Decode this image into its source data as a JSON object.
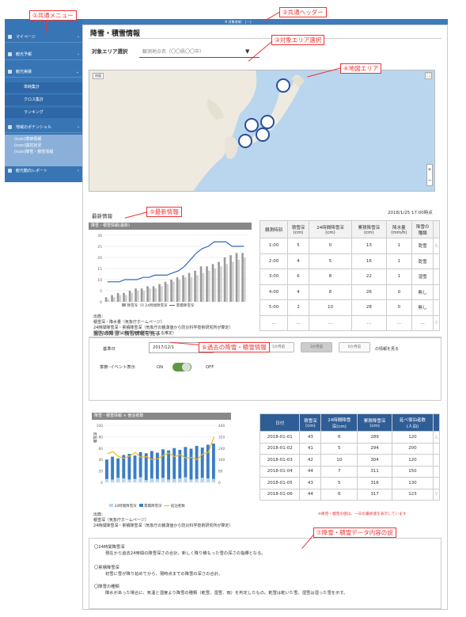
{
  "annotations": {
    "a1": "①共通メニュー",
    "a2": "②共通ヘッダー",
    "a3": "③対象エリア選択",
    "a4": "④地図エリア",
    "a5": "⑤最新情報",
    "a6": "⑥過去の降雪・積雪情報",
    "a7": "⑦降雪・積雪データ内容の説"
  },
  "header": {
    "center_text": "※ 対象地域： | ─ |"
  },
  "sidebar": {
    "items": [
      {
        "label": "マイページ"
      },
      {
        "label": "観光予報"
      },
      {
        "label": "観光実績"
      },
      {
        "label": "地域のポテンシャル"
      },
      {
        "label": "観光動向レポート"
      }
    ],
    "sub_items": [
      {
        "label": "単純集計"
      },
      {
        "label": "クロス集計"
      },
      {
        "label": "ランキング"
      }
    ],
    "extra_lines": [
      "(icon)季節情報",
      "(icon)開花状況",
      "(icon)降雪・積雪情報"
    ]
  },
  "page": {
    "title": "降雪・積雪情報"
  },
  "area": {
    "label": "対象エリア選択",
    "value": "観測地点名（〇〇県〇〇市）"
  },
  "latest": {
    "heading": "最新情報",
    "timestamp": "2018/1/25 17:00時点",
    "chart_title": "降雪・積雪情報(最新)",
    "legend": [
      "降雪深",
      "24時間降雪深",
      "累積降雪深"
    ],
    "source": [
      "出典：",
      "積雪深・降水量（気象庁ホームページ）",
      "24時間降雪深・累積降雪深（気象庁の観測値から防災科学技術研究所が算定）",
      "降雪の種類（防災科学技術研究所による推定）"
    ],
    "table_headers": [
      "観測時刻",
      "積雪深\n(cm)",
      "24時間降雪深\n(cm)",
      "累積降雪深\n(cm)",
      "降水量\n(mm/h)",
      "降雪の\n種類"
    ],
    "rows": [
      [
        "1:00",
        "5",
        "0",
        "13",
        "1",
        "乾雪"
      ],
      [
        "2:00",
        "4",
        "5",
        "16",
        "1",
        "乾雪"
      ],
      [
        "3:00",
        "6",
        "8",
        "22",
        "1",
        "湿雪"
      ],
      [
        "4:00",
        "4",
        "8",
        "26",
        "0",
        "無し"
      ],
      [
        "5:00",
        "2",
        "10",
        "28",
        "0",
        "無し"
      ],
      [
        "…",
        "…",
        "…",
        "…",
        "…",
        "…"
      ]
    ]
  },
  "past": {
    "heading": "過去の降雪・積雪情報を見る",
    "base_date_label": "基準日",
    "base_date": "2017/12/1",
    "kara": "から",
    "buttons": [
      "1か月前",
      "3か月前",
      "6か月前"
    ],
    "after": "の情報を見る",
    "season_label": "季節･イベント表示",
    "on": "ON",
    "off": "OFF",
    "chart_title": "降雪・積雪情報 × 宿泊者数",
    "ylabel": "積雪深",
    "legend": [
      "24時間降雪深",
      "累積降雪深",
      "宿泊者数"
    ],
    "table_headers": [
      "日付",
      "積雪深\n(cm)",
      "24時間降雪\n深(cm)",
      "累積降雪深\n(cm)",
      "延べ宿泊者数\n(人泊)"
    ],
    "rows": [
      [
        "2018-01-01",
        "43",
        "6",
        "289",
        "120"
      ],
      [
        "2018-01-02",
        "41",
        "5",
        "294",
        "200"
      ],
      [
        "2018-01-03",
        "42",
        "10",
        "304",
        "120"
      ],
      [
        "2018-01-04",
        "44",
        "7",
        "311",
        "150"
      ],
      [
        "2018-01-05",
        "43",
        "5",
        "316",
        "130"
      ],
      [
        "2018-01-06",
        "44",
        "6",
        "317",
        "123"
      ]
    ],
    "note": "※降雪・積雪の値は、一日の最終値を表示しています",
    "source": [
      "出典：",
      "積雪深（気象庁ホームページ）",
      "24時間降雪深・累積降雪深（気象庁の観測値から防災科学技術研究所が算定）"
    ]
  },
  "explain": [
    {
      "t": "〇24時間降雪深",
      "d": "現在から過去24時間の降雪深さの合計。新しく降り積もった雪の深さの指標となる。"
    },
    {
      "t": "〇累積降雪深",
      "d": "初雪に雪が降り始めてから、現時点までの降雪の深さの合計。"
    },
    {
      "t": "〇降雪の種類",
      "d": "降水があった場合に、気温と湿度より降雪の種類（乾雪、湿雪、雨）を判定したもの。乾雪は乾いた雪、湿雪は湿った雪を示す。"
    }
  ],
  "chart_data": [
    {
      "type": "bar",
      "title": "降雪・積雪情報(最新)",
      "legend": [
        "降雪深",
        "24時間降雪深",
        "累積降雪深"
      ],
      "ylim": [
        0,
        30
      ],
      "series": [
        {
          "name": "降雪深",
          "values": [
            2,
            3,
            4,
            4,
            5,
            6,
            6,
            7,
            7,
            8,
            9,
            10,
            11,
            12,
            13,
            14,
            16,
            16,
            17,
            18,
            20,
            21,
            22,
            22
          ]
        },
        {
          "name": "24時間降雪深",
          "values": [
            1,
            2,
            3,
            3,
            4,
            5,
            5,
            6,
            6,
            7,
            8,
            9,
            10,
            11,
            11,
            12,
            13,
            14,
            15,
            16,
            17,
            18,
            19,
            20
          ]
        },
        {
          "name": "累積降雪深",
          "values": [
            9,
            9,
            9,
            10,
            10,
            10,
            11,
            11,
            12,
            12,
            12,
            13,
            14,
            16,
            19,
            22,
            24,
            25,
            27,
            27,
            27,
            25,
            25,
            25
          ]
        }
      ]
    },
    {
      "type": "bar",
      "title": "降雪・積雪情報 × 宿泊者数",
      "legend": [
        "24時間降雪深",
        "累積降雪深",
        "宿泊者数"
      ],
      "ylim": [
        0,
        100
      ],
      "y2lim": [
        0,
        400
      ],
      "series": [
        {
          "name": "24時間降雪深",
          "values": [
            6,
            5,
            8,
            7,
            5,
            6,
            9,
            4,
            7,
            6,
            8,
            5,
            6,
            7,
            9,
            5,
            6,
            8,
            7,
            6
          ]
        },
        {
          "name": "累積降雪深",
          "values": [
            40,
            45,
            42,
            48,
            50,
            47,
            53,
            51,
            55,
            52,
            58,
            56,
            60,
            57,
            62,
            59,
            64,
            61,
            66,
            68
          ]
        },
        {
          "name": "宿泊者数",
          "values": [
            200,
            215,
            180,
            170,
            185,
            210,
            175,
            180,
            160,
            165,
            190,
            205,
            180,
            195,
            170,
            175,
            160,
            200,
            210,
            320
          ]
        }
      ]
    }
  ]
}
